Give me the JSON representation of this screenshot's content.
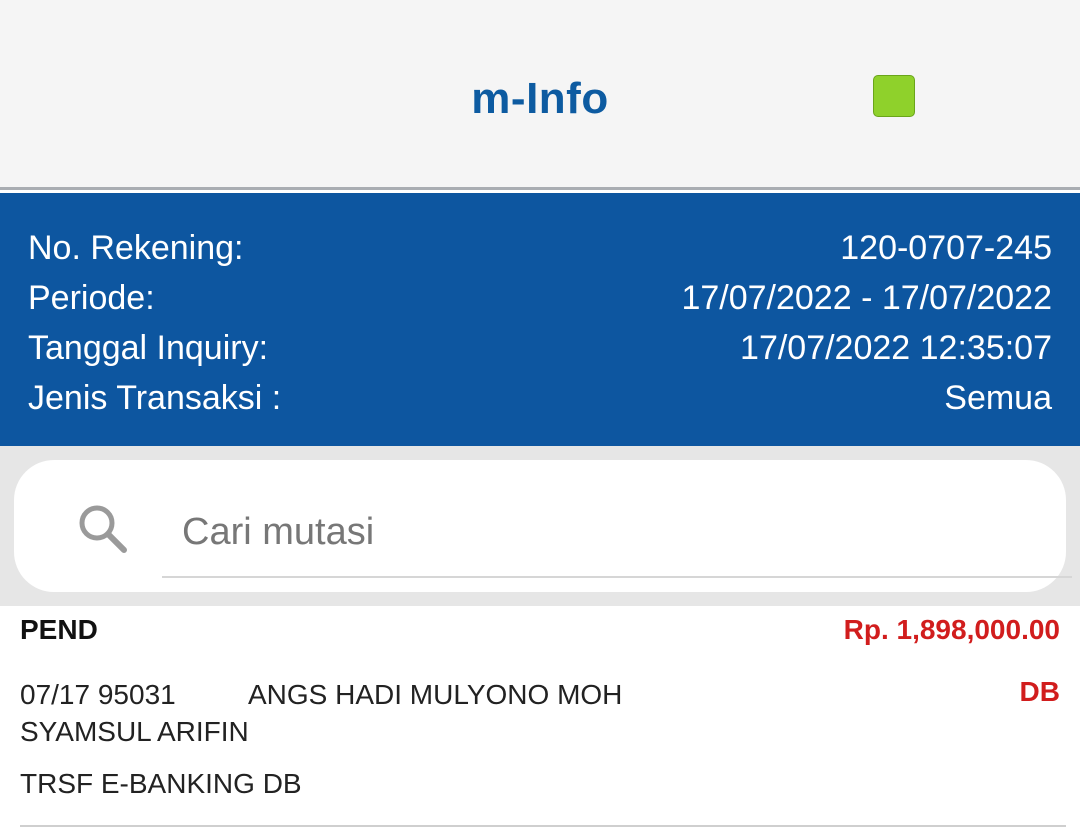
{
  "header": {
    "title": "m-Info",
    "status_color": "#8fd12b"
  },
  "info": {
    "rows": [
      {
        "label": "No. Rekening:",
        "value": "120-0707-245"
      },
      {
        "label": "Periode:",
        "value": "17/07/2022 - 17/07/2022"
      },
      {
        "label": "Tanggal Inquiry:",
        "value": "17/07/2022 12:35:07"
      },
      {
        "label": "Jenis Transaksi :",
        "value": "Semua"
      }
    ]
  },
  "search": {
    "placeholder": "Cari mutasi",
    "value": "",
    "icon": "search-icon"
  },
  "transactions": [
    {
      "status": "PEND",
      "amount": "Rp. 1,898,000.00",
      "date_code": "07/17 95031",
      "description_line1": "ANGS HADI MULYONO MOH",
      "description_line2": "SYAMSUL ARIFIN",
      "type": "DB",
      "note": "TRSF E-BANKING DB"
    }
  ],
  "colors": {
    "brand_blue": "#0d56a0",
    "title_blue": "#0d5ba1",
    "debit_red": "#d11d1d"
  }
}
